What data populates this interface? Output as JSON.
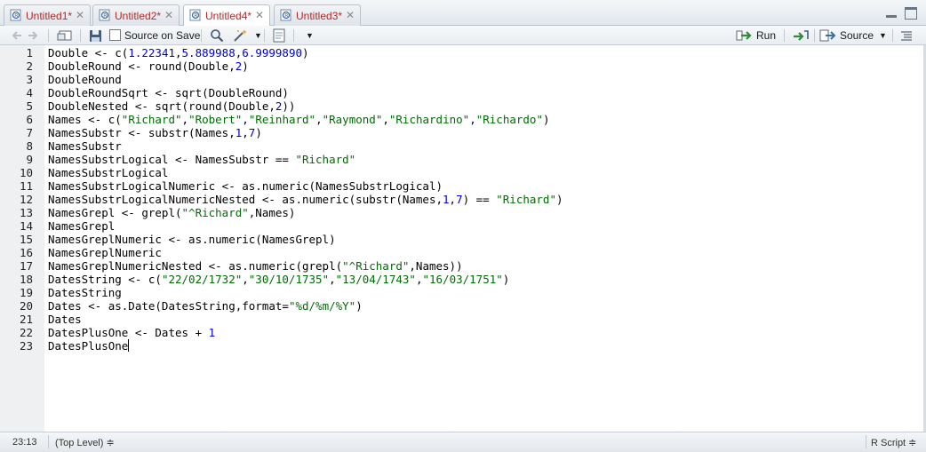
{
  "tabs": [
    {
      "label": "Untitled1*",
      "active": false
    },
    {
      "label": "Untitled2*",
      "active": false
    },
    {
      "label": "Untitled4*",
      "active": true
    },
    {
      "label": "Untitled3*",
      "active": false
    }
  ],
  "toolbar": {
    "source_on_save": "Source on Save",
    "run": "Run",
    "source": "Source"
  },
  "editor": {
    "lines": [
      {
        "n": "1",
        "tokens": [
          [
            "p",
            "Double <- c("
          ],
          [
            "n",
            "1.22341"
          ],
          [
            "p",
            ","
          ],
          [
            "n",
            "5.889988"
          ],
          [
            "p",
            ","
          ],
          [
            "n",
            "6.9999890"
          ],
          [
            "p",
            ")"
          ]
        ]
      },
      {
        "n": "2",
        "tokens": [
          [
            "p",
            "DoubleRound <- round(Double,"
          ],
          [
            "n",
            "2"
          ],
          [
            "p",
            ")"
          ]
        ]
      },
      {
        "n": "3",
        "tokens": [
          [
            "p",
            "DoubleRound"
          ]
        ]
      },
      {
        "n": "4",
        "tokens": [
          [
            "p",
            "DoubleRoundSqrt <- sqrt(DoubleRound)"
          ]
        ]
      },
      {
        "n": "5",
        "tokens": [
          [
            "p",
            "DoubleNested <- sqrt(round(Double,"
          ],
          [
            "n",
            "2"
          ],
          [
            "p",
            "))"
          ]
        ]
      },
      {
        "n": "6",
        "tokens": [
          [
            "p",
            "Names <- c("
          ],
          [
            "s",
            "\"Richard\""
          ],
          [
            "p",
            ","
          ],
          [
            "s",
            "\"Robert\""
          ],
          [
            "p",
            ","
          ],
          [
            "s",
            "\"Reinhard\""
          ],
          [
            "p",
            ","
          ],
          [
            "s",
            "\"Raymond\""
          ],
          [
            "p",
            ","
          ],
          [
            "s",
            "\"Richardino\""
          ],
          [
            "p",
            ","
          ],
          [
            "s",
            "\"Richardo\""
          ],
          [
            "p",
            ")"
          ]
        ]
      },
      {
        "n": "7",
        "tokens": [
          [
            "p",
            "NamesSubstr <- substr(Names,"
          ],
          [
            "n",
            "1"
          ],
          [
            "p",
            ","
          ],
          [
            "n",
            "7"
          ],
          [
            "p",
            ")"
          ]
        ]
      },
      {
        "n": "8",
        "tokens": [
          [
            "p",
            "NamesSubstr"
          ]
        ]
      },
      {
        "n": "9",
        "tokens": [
          [
            "p",
            "NamesSubstrLogical <- NamesSubstr == "
          ],
          [
            "s",
            "\"Richard\""
          ]
        ]
      },
      {
        "n": "10",
        "tokens": [
          [
            "p",
            "NamesSubstrLogical"
          ]
        ]
      },
      {
        "n": "11",
        "tokens": [
          [
            "p",
            "NamesSubstrLogicalNumeric <- as.numeric(NamesSubstrLogical)"
          ]
        ]
      },
      {
        "n": "12",
        "tokens": [
          [
            "p",
            "NamesSubstrLogicalNumericNested <- as.numeric(substr(Names,"
          ],
          [
            "n",
            "1"
          ],
          [
            "p",
            ","
          ],
          [
            "n",
            "7"
          ],
          [
            "p",
            ") == "
          ],
          [
            "s",
            "\"Richard\""
          ],
          [
            "p",
            ")"
          ]
        ]
      },
      {
        "n": "13",
        "tokens": [
          [
            "p",
            "NamesGrepl <- grepl("
          ],
          [
            "s",
            "\"^Richard\""
          ],
          [
            "p",
            ",Names)"
          ]
        ]
      },
      {
        "n": "14",
        "tokens": [
          [
            "p",
            "NamesGrepl"
          ]
        ]
      },
      {
        "n": "15",
        "tokens": [
          [
            "p",
            "NamesGreplNumeric <- as.numeric(NamesGrepl)"
          ]
        ]
      },
      {
        "n": "16",
        "tokens": [
          [
            "p",
            "NamesGreplNumeric"
          ]
        ]
      },
      {
        "n": "17",
        "tokens": [
          [
            "p",
            "NamesGreplNumericNested <- as.numeric(grepl("
          ],
          [
            "s",
            "\"^Richard\""
          ],
          [
            "p",
            ",Names))"
          ]
        ]
      },
      {
        "n": "18",
        "tokens": [
          [
            "p",
            "DatesString <- c("
          ],
          [
            "s",
            "\"22/02/1732\""
          ],
          [
            "p",
            ","
          ],
          [
            "s",
            "\"30/10/1735\""
          ],
          [
            "p",
            ","
          ],
          [
            "s",
            "\"13/04/1743\""
          ],
          [
            "p",
            ","
          ],
          [
            "s",
            "\"16/03/1751\""
          ],
          [
            "p",
            ")"
          ]
        ]
      },
      {
        "n": "19",
        "tokens": [
          [
            "p",
            "DatesString"
          ]
        ]
      },
      {
        "n": "20",
        "tokens": [
          [
            "p",
            "Dates <- as.Date(DatesString,format="
          ],
          [
            "s",
            "\"%d/%m/%Y\""
          ],
          [
            "p",
            ")"
          ]
        ]
      },
      {
        "n": "21",
        "tokens": [
          [
            "p",
            "Dates"
          ]
        ]
      },
      {
        "n": "22",
        "tokens": [
          [
            "p",
            "DatesPlusOne <- Dates + "
          ],
          [
            "n",
            "1"
          ]
        ]
      },
      {
        "n": "23",
        "tokens": [
          [
            "p",
            "DatesPlusOne"
          ]
        ]
      }
    ]
  },
  "statusbar": {
    "position": "23:13",
    "scope": "(Top Level) ≑",
    "filetype": "R Script ≑"
  },
  "colors": {
    "tab_text": "#b22a2a",
    "string": "#036a07",
    "number": "#0000cd"
  }
}
